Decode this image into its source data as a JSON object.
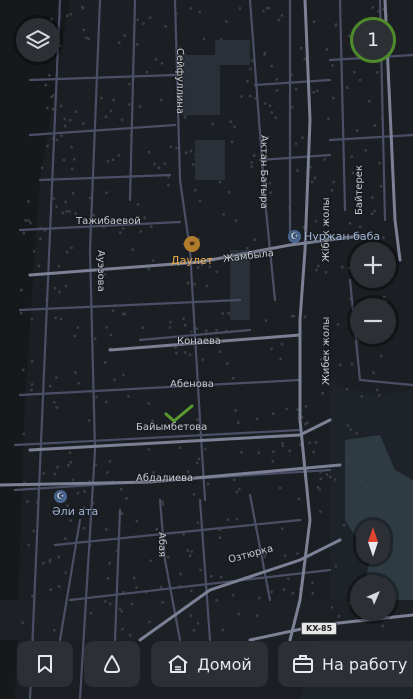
{
  "map": {
    "streets": {
      "seifullina": "Сейфуллина",
      "aktan_batyra": "Актан Батыра",
      "zhibek_zholy_north": "Жібек жолы",
      "zhibek_zholy_south": "Жибек жолы",
      "baiterek": "Байтерек",
      "tazhibaevoi": "Тажибаевой",
      "auezova": "Ауэзова",
      "zhambyla": "Жамбыла",
      "konaeva": "Конаева",
      "abenova": "Абенова",
      "baiymbetova": "Байымбетова",
      "abdalieva": "Абдалиева",
      "abai": "Абая",
      "oztyrka": "Озтюрка"
    },
    "pois": {
      "mosque_nurzhan": "Нуржан баба",
      "mosque_ali_ata": "Әли ата",
      "cafe_daulet": "Даулет"
    },
    "road_shield": "KX-85",
    "accent_green": "#5a9a2e",
    "mosque_color": "#4c6a96",
    "cafe_color": "#b07b2c"
  },
  "controls": {
    "layers_icon": "layers-icon",
    "counter_value": "1",
    "zoom_in_icon": "plus-icon",
    "zoom_out_icon": "minus-icon",
    "compass_icon": "compass-icon",
    "locate_icon": "navigation-arrow-icon"
  },
  "bottom_bar": {
    "bookmarks_icon": "bookmark-icon",
    "alice_icon": "alice-icon",
    "home_label": "Домой",
    "work_label": "На работу"
  }
}
